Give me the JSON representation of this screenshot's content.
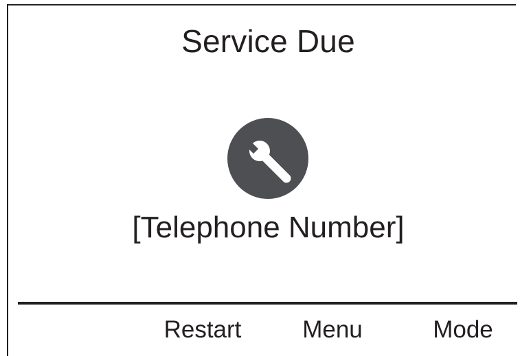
{
  "display": {
    "title": "Service Due",
    "icon": "wrench-icon",
    "contact": "[Telephone Number]"
  },
  "softkeys": [
    {
      "label": "",
      "name": "softkey-1-blank"
    },
    {
      "label": "Restart"
    },
    {
      "label": "Menu"
    },
    {
      "label": "Mode"
    }
  ],
  "colors": {
    "ink": "#231f20",
    "icon_fill": "#4d4f53",
    "background": "#ffffff"
  }
}
